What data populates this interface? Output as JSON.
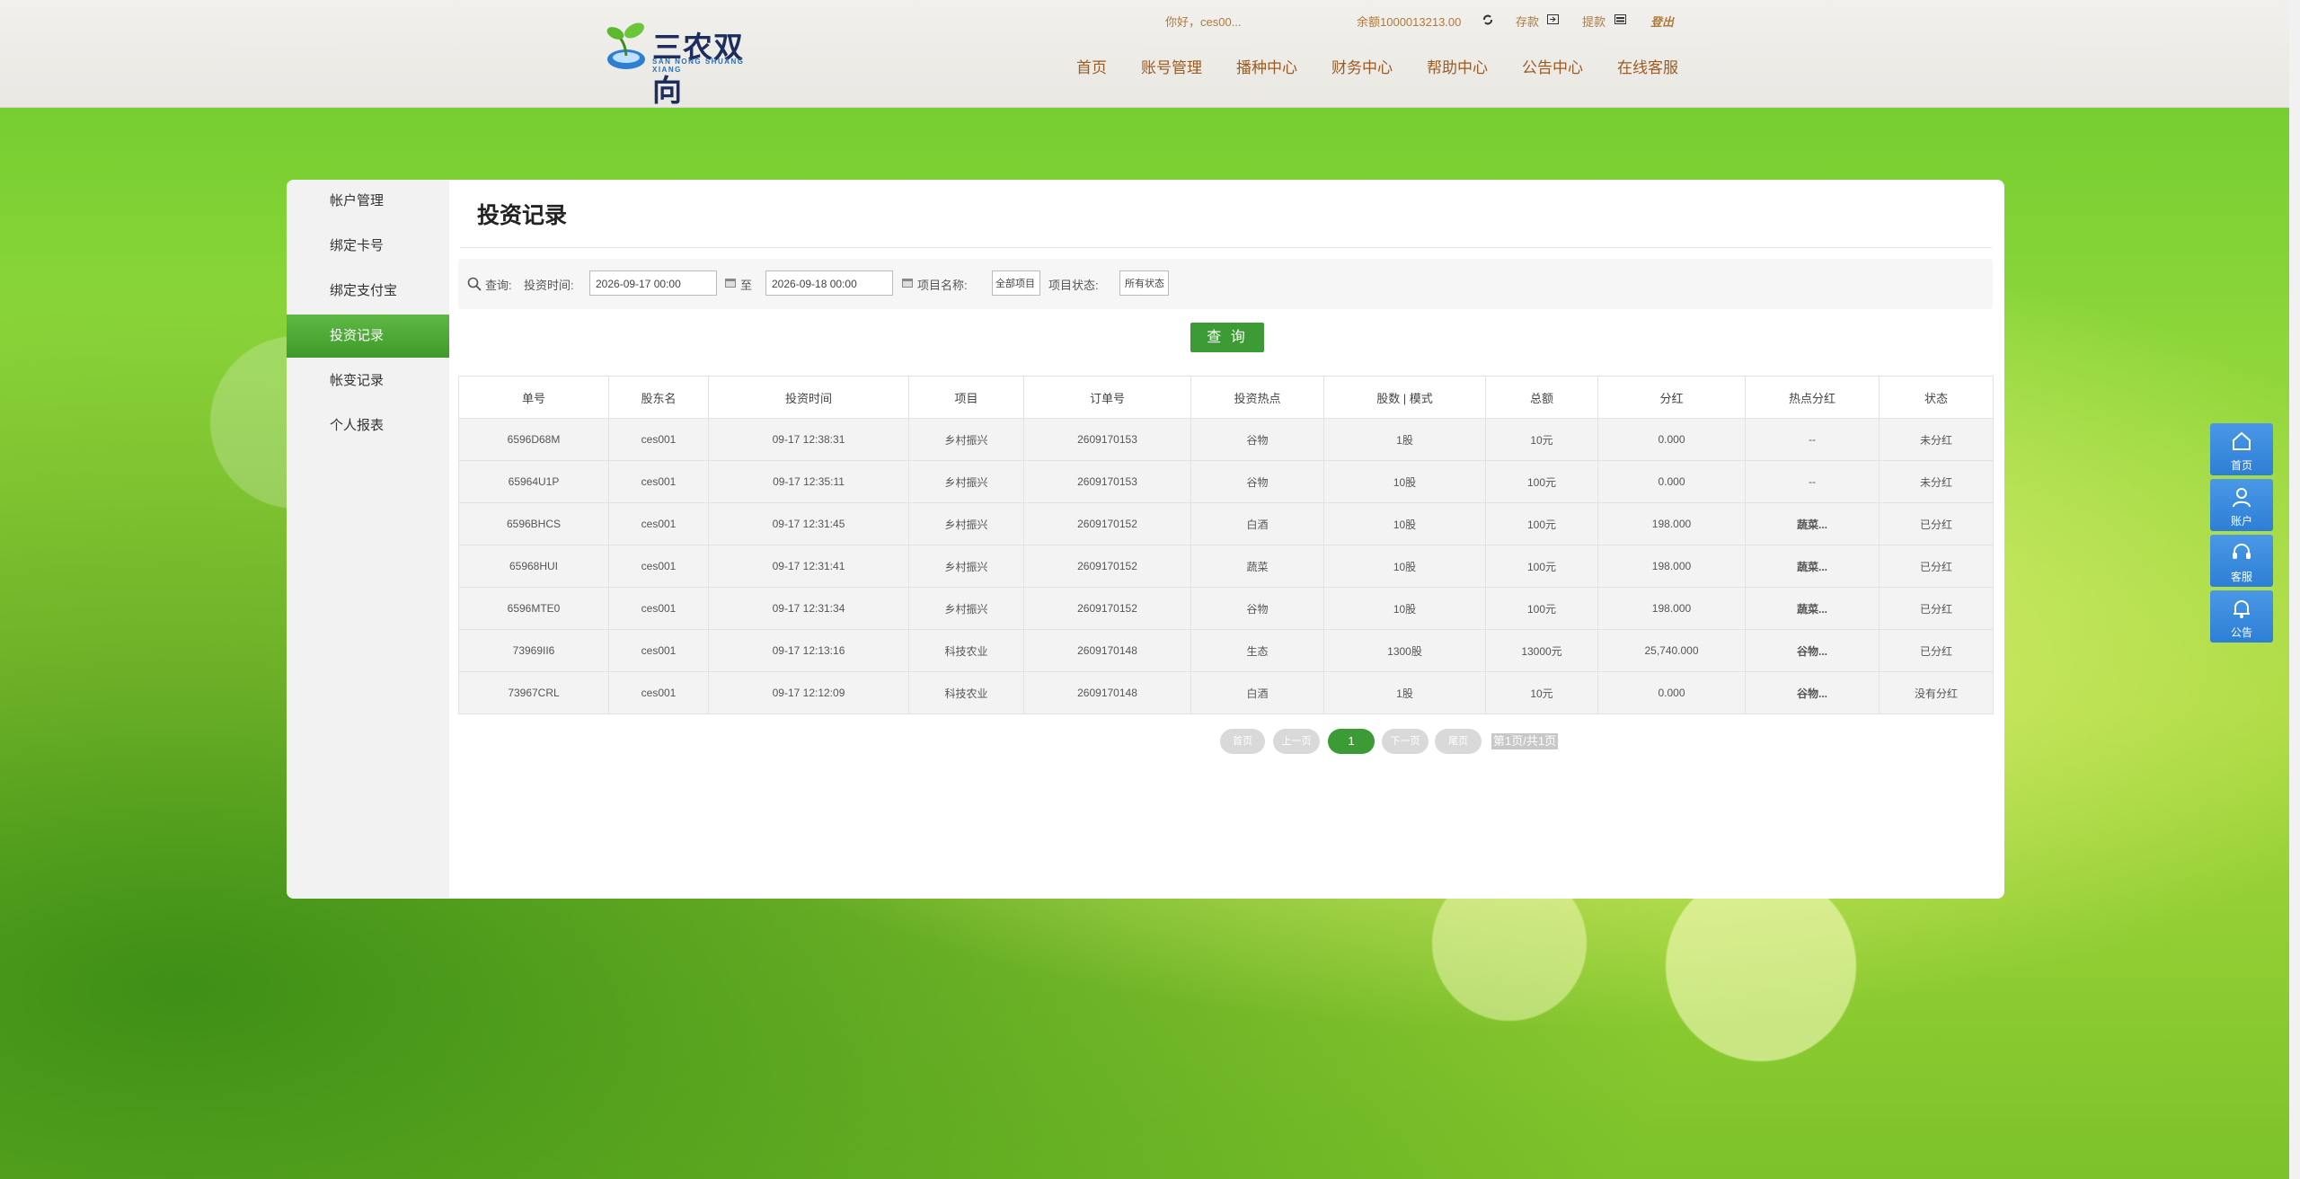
{
  "header": {
    "logo_text": "三农双向",
    "logo_sub": "SAN NONG SHUANG XIANG",
    "greeting": "你好，ces00...",
    "balance": "余额1000013213.00",
    "deposit": "存款",
    "withdraw": "提款",
    "logout": "登出",
    "nav": [
      "首页",
      "账号管理",
      "播种中心",
      "财务中心",
      "帮助中心",
      "公告中心",
      "在线客服"
    ]
  },
  "sidebar": {
    "items": [
      "帐户管理",
      "绑定卡号",
      "绑定支付宝",
      "投资记录",
      "帐变记录",
      "个人报表"
    ],
    "active_index": 3
  },
  "main": {
    "title": "投资记录",
    "filter": {
      "query_label": "查询:",
      "time_label": "投资时间:",
      "start": "2026-09-17 00:00",
      "to": "至",
      "end": "2026-09-18 00:00",
      "project_label": "项目名称:",
      "project_value": "全部项目",
      "status_label": "项目状态:",
      "status_value": "所有状态"
    },
    "query_button": "查 询",
    "table": {
      "columns": [
        "单号",
        "股东名",
        "投资时间",
        "项目",
        "订单号",
        "投资热点",
        "股数 | 模式",
        "总额",
        "分红",
        "热点分红",
        "状态"
      ],
      "rows": [
        [
          "6596D68M",
          "ces001",
          "09-17 12:38:31",
          "乡村振兴",
          "2609170153",
          "谷物",
          "1股",
          "10元",
          "0.000",
          "--",
          "未分红"
        ],
        [
          "65964U1P",
          "ces001",
          "09-17 12:35:11",
          "乡村振兴",
          "2609170153",
          "谷物",
          "10股",
          "100元",
          "0.000",
          "--",
          "未分红"
        ],
        [
          "6596BHCS",
          "ces001",
          "09-17 12:31:45",
          "乡村振兴",
          "2609170152",
          "白酒",
          "10股",
          "100元",
          "198.000",
          "蔬菜...",
          "已分红"
        ],
        [
          "65968HUI",
          "ces001",
          "09-17 12:31:41",
          "乡村振兴",
          "2609170152",
          "蔬菜",
          "10股",
          "100元",
          "198.000",
          "蔬菜...",
          "已分红"
        ],
        [
          "6596MTE0",
          "ces001",
          "09-17 12:31:34",
          "乡村振兴",
          "2609170152",
          "谷物",
          "10股",
          "100元",
          "198.000",
          "蔬菜...",
          "已分红"
        ],
        [
          "73969II6",
          "ces001",
          "09-17 12:13:16",
          "科技农业",
          "2609170148",
          "生态",
          "1300股",
          "13000元",
          "25,740.000",
          "谷物...",
          "已分红"
        ],
        [
          "73967CRL",
          "ces001",
          "09-17 12:12:09",
          "科技农业",
          "2609170148",
          "白酒",
          "1股",
          "10元",
          "0.000",
          "谷物...",
          "没有分红"
        ]
      ],
      "status_classes": [
        "st-green",
        "st-green",
        "st-red",
        "st-red",
        "st-red",
        "st-red",
        ""
      ],
      "hot_classes": [
        "st-red",
        "st-red",
        "hot-red",
        "hot-red",
        "hot-red",
        "hot-red",
        "hot-red"
      ]
    },
    "pager": {
      "first": "首页",
      "prev": "上一页",
      "current": "1",
      "next": "下一页",
      "last": "尾页",
      "info": "第1页/共1页"
    }
  },
  "float_bar": [
    "首页",
    "账户",
    "客服",
    "公告"
  ],
  "colors": {
    "accent": "#3d9b35",
    "float_blue": "#2d7fd6",
    "nav_brown": "#9b5b23"
  }
}
